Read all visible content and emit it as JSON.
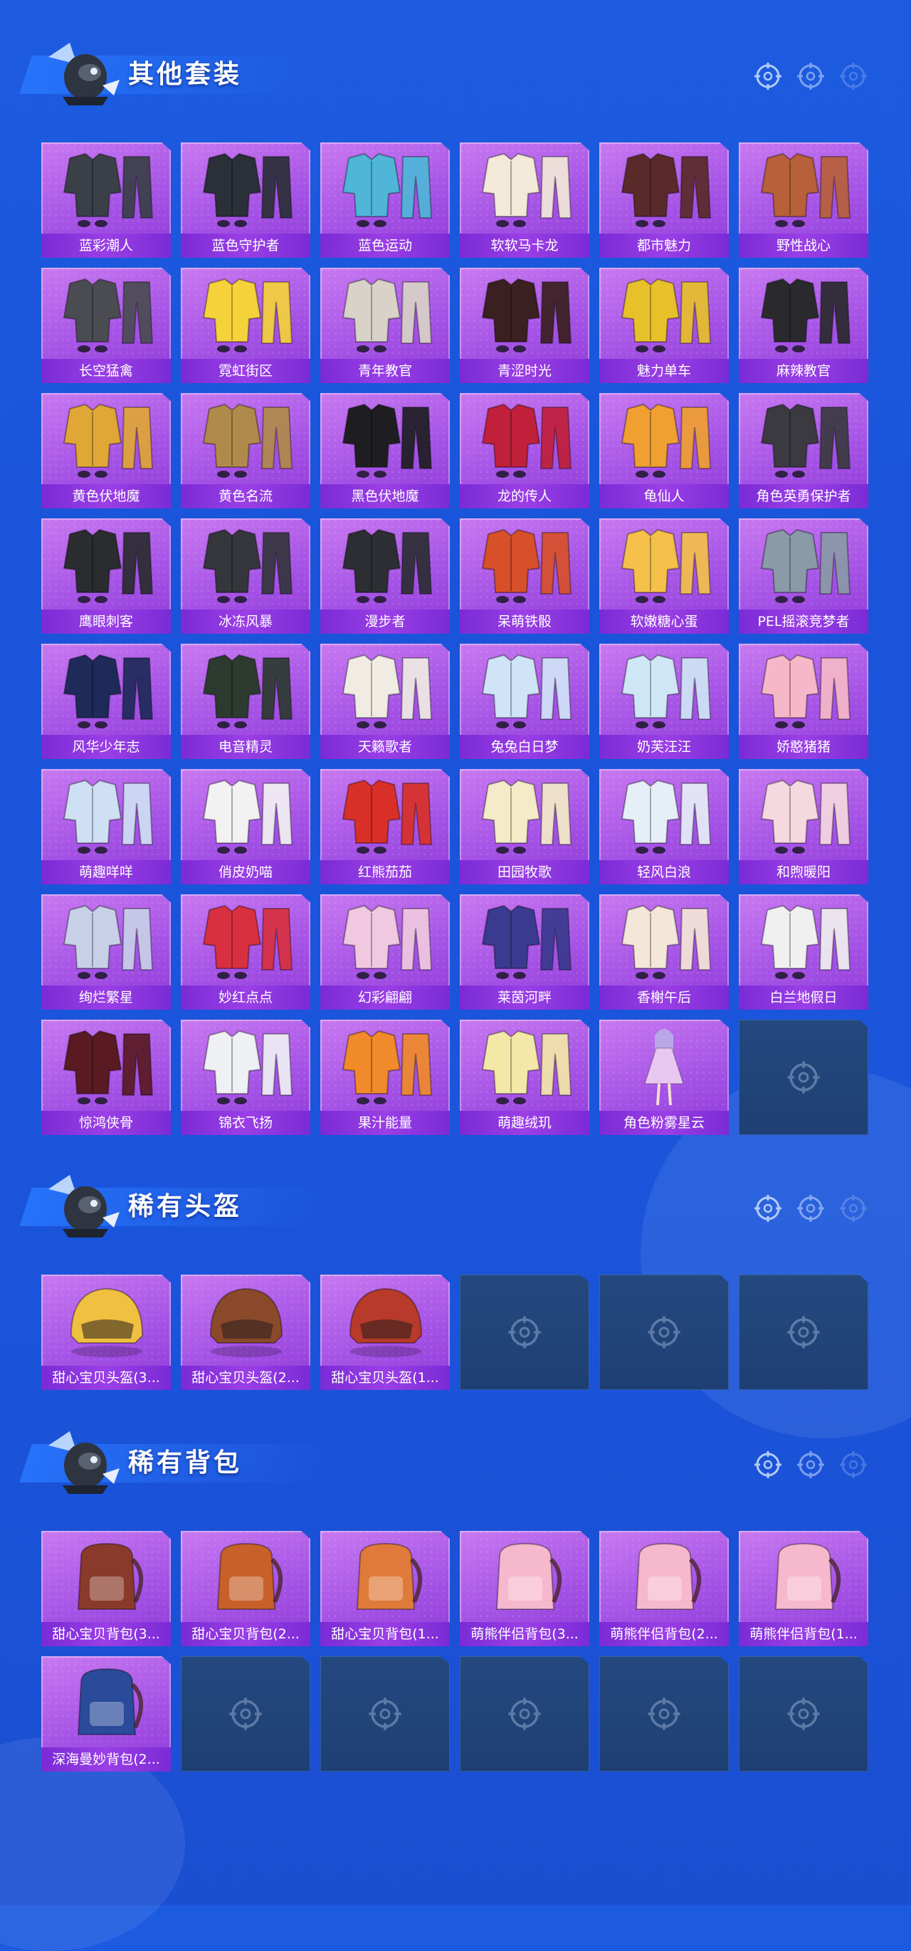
{
  "colors": {
    "background": "#1c5be0",
    "tile_purple": "#a654e6",
    "label_band": "#8a35de",
    "empty_tile": "#22467c"
  },
  "sections": [
    {
      "title": "其他套装",
      "items": [
        {
          "label": "蓝彩潮人",
          "icon": "outfit-icon",
          "color": "#3a3f48"
        },
        {
          "label": "蓝色守护者",
          "icon": "outfit-icon",
          "color": "#2b2f38"
        },
        {
          "label": "蓝色运动",
          "icon": "outfit-icon",
          "color": "#4fb6d8"
        },
        {
          "label": "软软马卡龙",
          "icon": "outfit-icon",
          "color": "#f2e9d8"
        },
        {
          "label": "都市魅力",
          "icon": "outfit-icon",
          "color": "#5a2a2a"
        },
        {
          "label": "野性战心",
          "icon": "outfit-icon",
          "color": "#b8603a"
        },
        {
          "label": "长空猛禽",
          "icon": "outfit-icon",
          "color": "#4a4c52"
        },
        {
          "label": "霓虹街区",
          "icon": "outfit-icon",
          "color": "#f5d23a"
        },
        {
          "label": "青年教官",
          "icon": "outfit-icon",
          "color": "#d8d2c8"
        },
        {
          "label": "青涩时光",
          "icon": "outfit-icon",
          "color": "#3a2020"
        },
        {
          "label": "魅力单车",
          "icon": "outfit-icon",
          "color": "#e8c02a"
        },
        {
          "label": "麻辣教官",
          "icon": "outfit-icon",
          "color": "#2a2a2e"
        },
        {
          "label": "黄色伏地魔",
          "icon": "outfit-icon",
          "color": "#e0a636"
        },
        {
          "label": "黄色名流",
          "icon": "outfit-icon",
          "color": "#b08a4a"
        },
        {
          "label": "黑色伏地魔",
          "icon": "outfit-icon",
          "color": "#1e1e22"
        },
        {
          "label": "龙的传人",
          "icon": "outfit-icon",
          "color": "#c0203a"
        },
        {
          "label": "龟仙人",
          "icon": "outfit-icon",
          "color": "#f0a030"
        },
        {
          "label": "角色英勇保护者",
          "icon": "outfit-icon",
          "color": "#3a3a40"
        },
        {
          "label": "鹰眼刺客",
          "icon": "outfit-icon",
          "color": "#2a2c30"
        },
        {
          "label": "冰冻风暴",
          "icon": "outfit-icon",
          "color": "#34363c"
        },
        {
          "label": "漫步者",
          "icon": "outfit-icon",
          "color": "#2c2e34"
        },
        {
          "label": "呆萌铁骰",
          "icon": "outfit-icon",
          "color": "#d8502a"
        },
        {
          "label": "软嫩糖心蛋",
          "icon": "outfit-icon",
          "color": "#f5c04a"
        },
        {
          "label": "PEL摇滚竞梦者",
          "icon": "outfit-icon",
          "color": "#8a9aa8"
        },
        {
          "label": "风华少年志",
          "icon": "outfit-icon",
          "color": "#1e2a5a"
        },
        {
          "label": "电音精灵",
          "icon": "outfit-icon",
          "color": "#2c3a30"
        },
        {
          "label": "天籁歌者",
          "icon": "outfit-icon",
          "color": "#f0ece4"
        },
        {
          "label": "兔兔白日梦",
          "icon": "outfit-icon",
          "color": "#d0e4f8"
        },
        {
          "label": "奶芙汪汪",
          "icon": "outfit-icon",
          "color": "#cfe6f6"
        },
        {
          "label": "娇憨猪猪",
          "icon": "outfit-icon",
          "color": "#f6b8c8"
        },
        {
          "label": "萌趣咩咩",
          "icon": "outfit-icon",
          "color": "#cfe0f4"
        },
        {
          "label": "俏皮奶喵",
          "icon": "outfit-icon",
          "color": "#f2f2f2"
        },
        {
          "label": "红熊茄茄",
          "icon": "outfit-icon",
          "color": "#d83028"
        },
        {
          "label": "田园牧歌",
          "icon": "outfit-icon",
          "color": "#f4ecc8"
        },
        {
          "label": "轻风白浪",
          "icon": "outfit-icon",
          "color": "#e6eef8"
        },
        {
          "label": "和煦暖阳",
          "icon": "outfit-icon",
          "color": "#f6d8e0"
        },
        {
          "label": "绚烂繁星",
          "icon": "outfit-icon",
          "color": "#c8d0e8"
        },
        {
          "label": "妙红点点",
          "icon": "outfit-icon",
          "color": "#d83040"
        },
        {
          "label": "幻彩翩翩",
          "icon": "outfit-icon",
          "color": "#f0c8e0"
        },
        {
          "label": "莱茵河畔",
          "icon": "outfit-icon",
          "color": "#3a3a90"
        },
        {
          "label": "香榭午后",
          "icon": "outfit-icon",
          "color": "#f4e6d8"
        },
        {
          "label": "白兰地假日",
          "icon": "outfit-icon",
          "color": "#f0f0f0"
        },
        {
          "label": "惊鸿侠骨",
          "icon": "outfit-icon",
          "color": "#5a1a22"
        },
        {
          "label": "锦衣飞扬",
          "icon": "outfit-icon",
          "color": "#eef0f4"
        },
        {
          "label": "果汁能量",
          "icon": "outfit-icon",
          "color": "#f08a2a"
        },
        {
          "label": "萌趣绒玑",
          "icon": "outfit-icon",
          "color": "#f4e8a8"
        },
        {
          "label": "角色粉雾星云",
          "icon": "character-icon",
          "color": "#e8c8f0"
        },
        {
          "empty": true
        }
      ]
    },
    {
      "title": "稀有头盔",
      "items": [
        {
          "label": "甜心宝贝头盔(3...",
          "icon": "helmet-icon",
          "color": "#f0c040"
        },
        {
          "label": "甜心宝贝头盔(2...",
          "icon": "helmet-icon",
          "color": "#8a4a2a"
        },
        {
          "label": "甜心宝贝头盔(1...",
          "icon": "helmet-icon",
          "color": "#b83a2a"
        },
        {
          "empty": true
        },
        {
          "empty": true
        },
        {
          "empty": true
        }
      ]
    },
    {
      "title": "稀有背包",
      "items": [
        {
          "label": "甜心宝贝背包(3...",
          "icon": "backpack-icon",
          "color": "#8a3a2a"
        },
        {
          "label": "甜心宝贝背包(2...",
          "icon": "backpack-icon",
          "color": "#c8602a"
        },
        {
          "label": "甜心宝贝背包(1...",
          "icon": "backpack-icon",
          "color": "#e07a3a"
        },
        {
          "label": "萌熊伴侣背包(3...",
          "icon": "backpack-icon",
          "color": "#f6b8cc"
        },
        {
          "label": "萌熊伴侣背包(2...",
          "icon": "backpack-icon",
          "color": "#f6b8cc"
        },
        {
          "label": "萌熊伴侣背包(1...",
          "icon": "backpack-icon",
          "color": "#f6b8cc"
        },
        {
          "label": "深海曼妙背包(2...",
          "icon": "backpack-icon",
          "color": "#2a4a9a"
        },
        {
          "empty": true
        },
        {
          "empty": true
        },
        {
          "empty": true
        },
        {
          "empty": true
        },
        {
          "empty": true
        }
      ]
    }
  ]
}
